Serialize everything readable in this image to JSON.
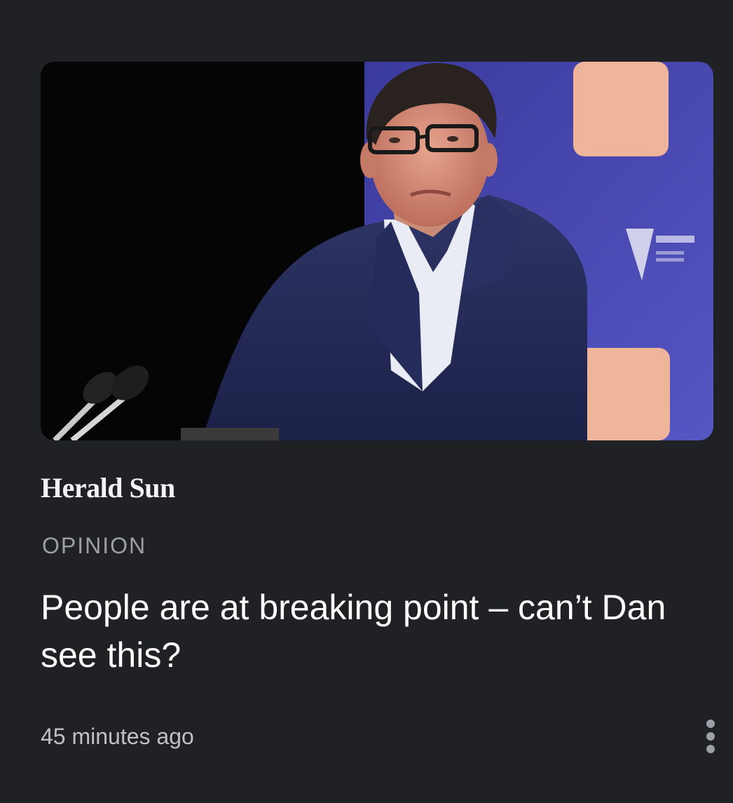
{
  "article": {
    "image_alt": "Man in glasses and navy suit standing at a lectern with microphones",
    "publisher": "Herald Sun",
    "kicker": "OPINION",
    "headline": "People are at breaking point – can’t Dan see this?",
    "timestamp": "45 minutes ago"
  },
  "actions": {
    "more_icon": "more-vert-icon"
  },
  "colors": {
    "background": "#202124",
    "headline": "#ffffff",
    "kicker": "#9aa0a6",
    "timestamp": "#bdc1c6",
    "backdrop_purple": "#4a4bb0"
  }
}
